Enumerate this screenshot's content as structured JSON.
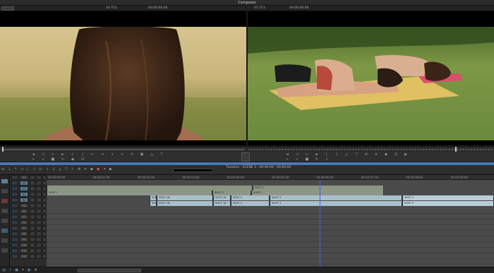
{
  "window": {
    "title": "Composer"
  },
  "composer": {
    "source_menu": "",
    "source_tc_label": "V1 TC1",
    "source_tc": "00:00:00:00",
    "record_tc_label": "V1 TC1",
    "record_tc": "00:00:00:00"
  },
  "timeline": {
    "sequence_name": "Timeline - SCENE 3 - 00:00:00 - 00:00:00",
    "sequence_sub": "",
    "ruler": [
      "00:00:00:00",
      "00:00:01:00",
      "00:00:02:00",
      "00:00:03:00",
      "00:00:04:00",
      "00:00:05:00",
      "00:00:06:00",
      "00:00:07:00",
      "00:00:08:00",
      "00:00:09:00"
    ],
    "tracks": [
      {
        "label": "V3",
        "active": false
      },
      {
        "label": "V2",
        "active": true
      },
      {
        "label": "V1",
        "active": true
      },
      {
        "label": "A1",
        "active": true
      },
      {
        "label": "A2",
        "active": true
      },
      {
        "label": "A3",
        "active": false
      },
      {
        "label": "A4",
        "active": false
      },
      {
        "label": "A5",
        "active": false
      },
      {
        "label": "A6",
        "active": false
      },
      {
        "label": "A7",
        "active": false
      },
      {
        "label": "A8",
        "active": false
      },
      {
        "label": "A9",
        "active": false
      },
      {
        "label": "A10",
        "active": false
      },
      {
        "label": "A11",
        "active": false
      },
      {
        "label": "A12",
        "active": false
      }
    ],
    "clips": {
      "v2_a": "",
      "v2_b": "SHOT 2",
      "v1_a": "SHOT 1",
      "v1_b": "SHOT 2",
      "v1_c": "SHOT 1",
      "a1_a": "SHOT 1B",
      "a1_b": "SHOT 1B",
      "a1_c": "SHOT 1B",
      "a1_d": "SHOT 2",
      "a1_e": "SHOT 1",
      "a1_f": "SHOT 3",
      "a2_a": "SHOT 1B",
      "a2_b": "SHOT 1B",
      "a2_c": "SHOT 1B",
      "a2_d": "SHOT 2",
      "a2_e": "SHOT 1",
      "a2_f": "SHOT 3"
    }
  },
  "colors": {
    "accent": "#4a78b5",
    "playhead": "#5160e0",
    "track_active": "#5f7f98",
    "clip_video": "#8e968a",
    "clip_audio": "#a9bfcb"
  }
}
